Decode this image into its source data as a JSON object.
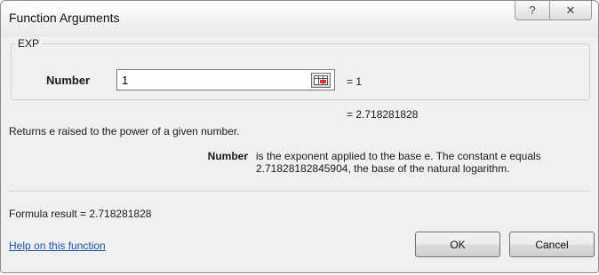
{
  "window": {
    "title": "Function Arguments"
  },
  "titlebar": {
    "help_glyph": "?",
    "close_glyph": "✕"
  },
  "function": {
    "name": "EXP",
    "argument_label": "Number",
    "argument_value": "1",
    "argument_result": "= 1",
    "function_result": "= 2.718281828"
  },
  "description": "Returns e raised to the power of a given number.",
  "argument_help": {
    "name": "Number",
    "text": "is the exponent applied to the base e. The constant e equals 2.71828182845904, the base of the natural logarithm."
  },
  "formula_result": "Formula result =   2.718281828",
  "help_link": "Help on this function",
  "buttons": {
    "ok": "OK",
    "cancel": "Cancel"
  }
}
